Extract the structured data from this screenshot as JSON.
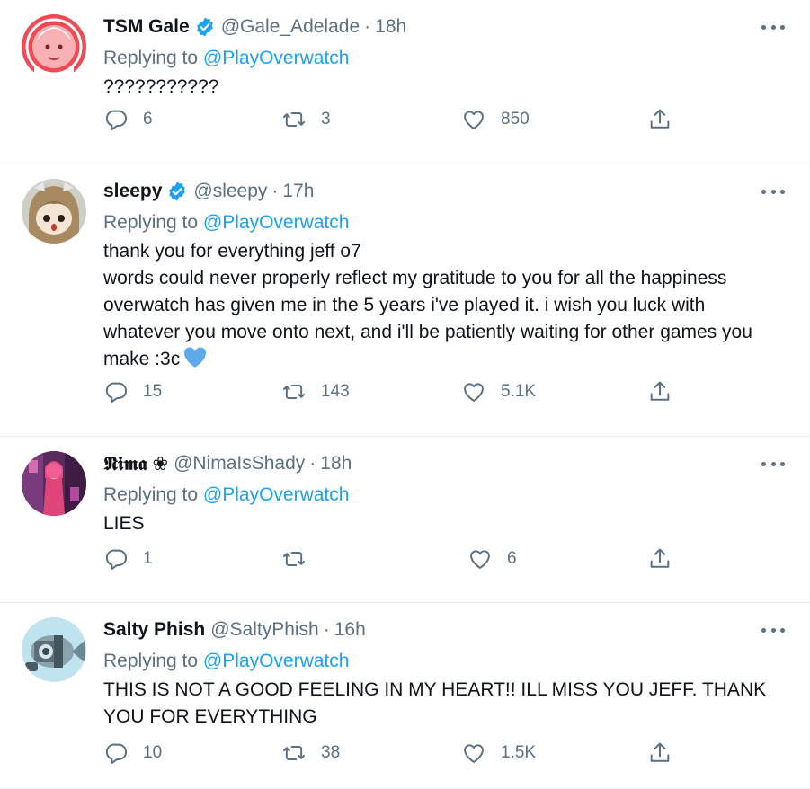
{
  "colors": {
    "accent": "#1da1f2",
    "secondary_text": "#5b7083",
    "divider": "#e6ecf0",
    "heart_emoji": "#5da9e9"
  },
  "reply_prefix": "Replying to",
  "tweets": [
    {
      "display_name": "TSM Gale",
      "verified": true,
      "handle": "@Gale_Adelade",
      "time": "18h",
      "replying_to": "@PlayOverwatch",
      "text": "???????????",
      "emoji": "",
      "replies": "6",
      "retweets": "3",
      "likes": "850"
    },
    {
      "display_name": "sleepy",
      "verified": true,
      "handle": "@sleepy",
      "time": "17h",
      "replying_to": "@PlayOverwatch",
      "text": "thank you for everything jeff o7\nwords could never properly reflect my gratitude to you for all the happiness overwatch has given me in the 5 years i've played it. i wish you luck with whatever you move onto next, and i'll be patiently waiting for other games you make :3c",
      "emoji": "blue-heart",
      "replies": "15",
      "retweets": "143",
      "likes": "5.1K"
    },
    {
      "display_name": "𝕹𝖎𝖒𝖆 ❀",
      "verified": false,
      "handle": "@NimaIsShady",
      "time": "18h",
      "replying_to": "@PlayOverwatch",
      "text": "LIES",
      "emoji": "",
      "replies": "1",
      "retweets": "",
      "likes": "6"
    },
    {
      "display_name": "Salty Phish",
      "verified": false,
      "handle": "@SaltyPhish",
      "time": "16h",
      "replying_to": "@PlayOverwatch",
      "text": "THIS IS NOT A GOOD FEELING IN MY HEART!! ILL MISS YOU JEFF. THANK YOU FOR EVERYTHING",
      "emoji": "",
      "replies": "10",
      "retweets": "38",
      "likes": "1.5K"
    }
  ],
  "icons": {
    "more": "more-dots-icon",
    "reply": "reply-bubble-icon",
    "retweet": "retweet-arrows-icon",
    "like": "heart-outline-icon",
    "share": "share-upload-icon",
    "verified": "verified-badge-icon"
  }
}
